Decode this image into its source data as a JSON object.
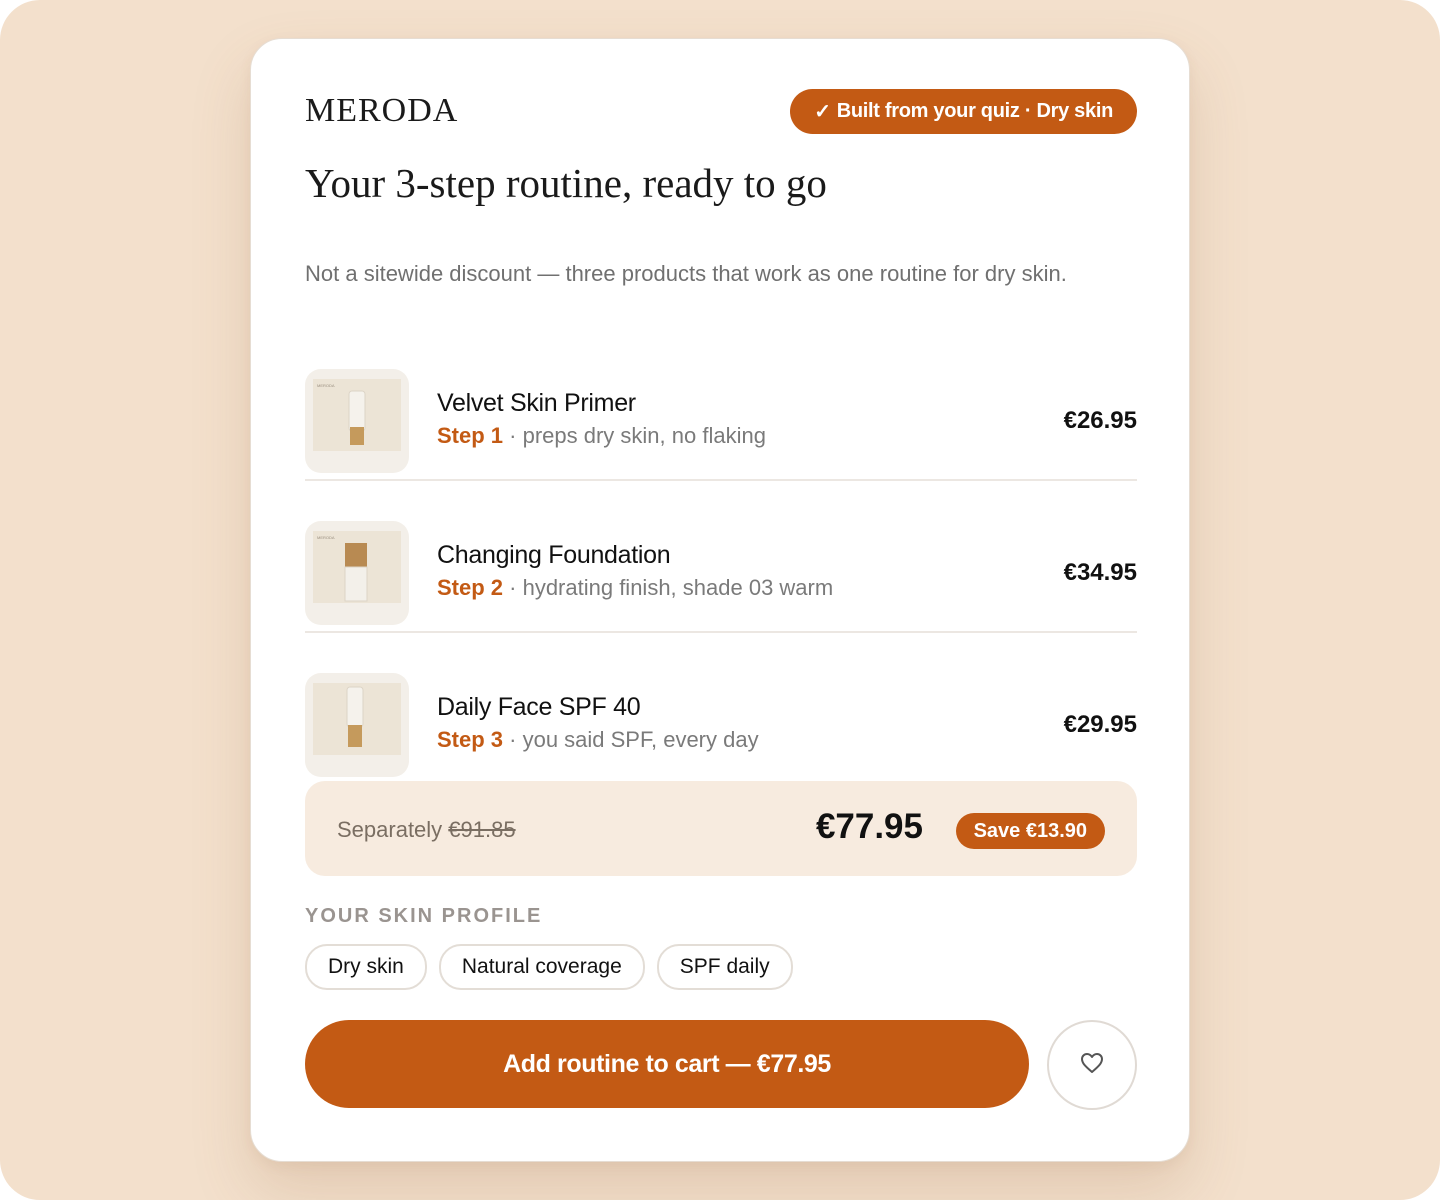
{
  "brand": {
    "logo": "MERODA"
  },
  "quiz_badge": {
    "check": "✓",
    "text": "Built from your quiz · Dry skin"
  },
  "title": "Your 3-step routine, ready to go",
  "subtitle": "Not a sitewide discount — three products that work as one routine for dry skin.",
  "products": [
    {
      "name": "Velvet Skin Primer",
      "step": "Step 1",
      "desc": " · preps dry skin, no flaking",
      "price": "€26.95",
      "thumb_icon": "tube-icon"
    },
    {
      "name": "Changing Foundation",
      "step": "Step 2",
      "desc": " · hydrating finish, shade 03 warm",
      "price": "€34.95",
      "thumb_icon": "bottle-icon"
    },
    {
      "name": "Daily Face SPF 40",
      "step": "Step 3",
      "desc": " · you said SPF, every day",
      "price": "€29.95",
      "thumb_icon": "tube-icon"
    }
  ],
  "summary": {
    "separately_label": "Separately ",
    "separately_price": "€91.85",
    "total": "€77.95",
    "save": "Save €13.90"
  },
  "profile": {
    "label": "YOUR SKIN PROFILE",
    "tags": [
      "Dry skin",
      "Natural coverage",
      "SPF daily"
    ]
  },
  "cta": {
    "label": "Add routine to cart — €77.95"
  },
  "favorite": {
    "icon": "heart-icon"
  },
  "colors": {
    "accent": "#c35a14",
    "backdrop": "#f3e0cc",
    "summary_bg": "#f7ebdf"
  }
}
